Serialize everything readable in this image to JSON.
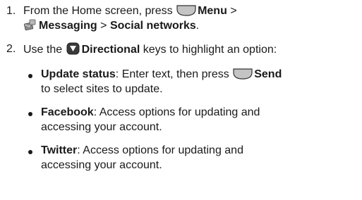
{
  "step1": {
    "number": "1.",
    "prefix": "From the Home screen, press",
    "menu_label": "Menu",
    "sep1": ">",
    "messaging_label": "Messaging",
    "sep2": ">",
    "social_label": "Social networks",
    "end": ".",
    "icons": [
      "left-softkey-icon",
      "messaging-app-icon"
    ]
  },
  "step2": {
    "number": "2.",
    "prefix": "Use the",
    "directional_label": "Directional",
    "suffix": "keys to highlight an option:",
    "icons": [
      "directional-key-icon"
    ]
  },
  "options": [
    {
      "term": "Update status",
      "text_part1": ": Enter text, then press",
      "send_label": "Send",
      "text_part2": "to select sites to update.",
      "icon": "right-softkey-icon"
    },
    {
      "term": "Facebook",
      "text_part1": ": Access options for updating and",
      "text_part2": "accessing your account."
    },
    {
      "term": "Twitter",
      "text_part1": ": Access options for updating and",
      "text_part2": "accessing your account."
    }
  ],
  "colors": {
    "text": "#1a1a1a",
    "key_fill": "#c4c4c4",
    "directional_key_fill": "#3a3a3a"
  }
}
